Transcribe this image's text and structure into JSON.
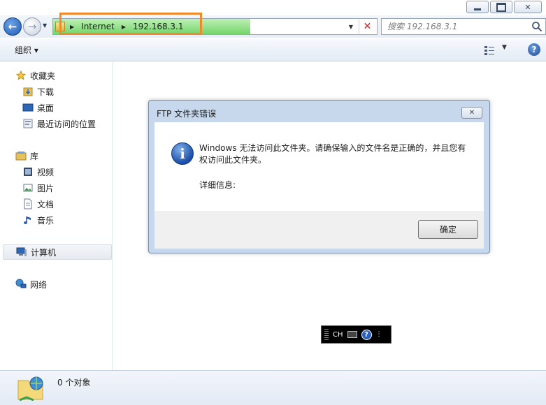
{
  "address_bar": {
    "crumbs": [
      "Internet",
      "192.168.3.1"
    ],
    "load_progress": 0.61
  },
  "search": {
    "placeholder": "搜索 192.168.3.1"
  },
  "toolbar": {
    "organize_label": "组织 ▾"
  },
  "nav": {
    "favorites": {
      "label": "收藏夹",
      "items": [
        "下载",
        "桌面",
        "最近访问的位置"
      ]
    },
    "libraries": {
      "label": "库",
      "items": [
        "视频",
        "图片",
        "文档",
        "音乐"
      ]
    },
    "computer": {
      "label": "计算机"
    },
    "network": {
      "label": "网络"
    }
  },
  "dialog": {
    "title": "FTP 文件夹错误",
    "message": "Windows 无法访问此文件夹。请确保输入的文件名是正确的，并且您有权访问此文件夹。",
    "details_label": "详细信息:",
    "ok_label": "确定",
    "icon": "info-icon"
  },
  "ime": {
    "label": "CH"
  },
  "status": {
    "object_count": "0 个对象"
  },
  "colors": {
    "highlight": "#f0892c",
    "progress": "#74d56a",
    "dialog_frame": "#c7d8ec"
  }
}
